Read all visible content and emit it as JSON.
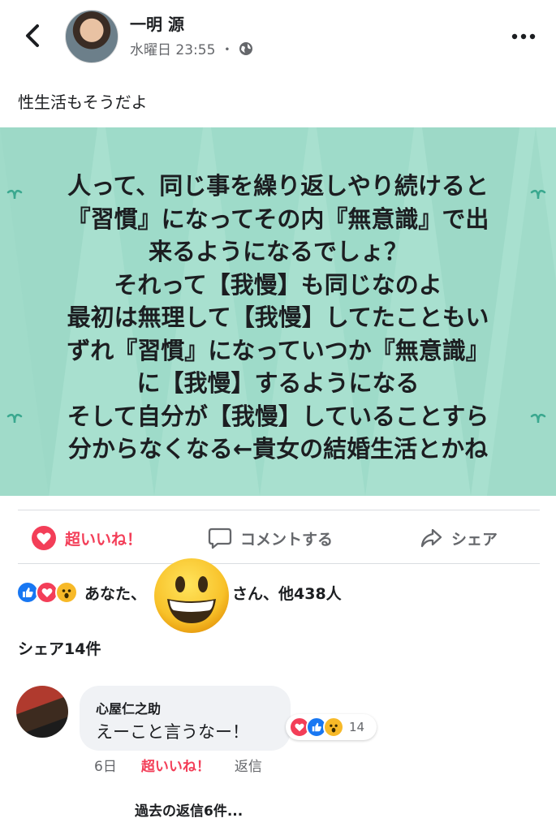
{
  "header": {
    "author_name": "一明 源",
    "timestamp": "水曜日 23:55",
    "separator": "・",
    "back_icon": "chevron-left-icon",
    "more_icon": "more-vertical-icon",
    "privacy_icon": "globe-icon"
  },
  "post": {
    "text": "性生活もそうだよ",
    "image_background": "#a8e0cf",
    "image_lines": [
      "人って、同じ事を繰り返しやり続けると",
      "『習慣』になってその内『無意識』で出",
      "来るようになるでしょ？",
      "それって【我慢】も同じなのよ",
      "最初は無理して【我慢】してたこともい",
      "ずれ『習慣』になっていつか『無意識』",
      "に【我慢】するようになる",
      "そして自分が【我慢】していることすら",
      "分からなくなる←貴女の結婚生活とかね"
    ]
  },
  "actions": {
    "like_label": "超いいね！",
    "comment_label": "コメントする",
    "share_label": "シェア",
    "like_color": "#f33e58"
  },
  "reactions": {
    "prefix": "あなた、",
    "suffix": "さん、他438人",
    "types": [
      "like",
      "love",
      "wow"
    ]
  },
  "shares": {
    "label": "シェア14件"
  },
  "comment": {
    "author": "心屋仁之助",
    "text": "えーこと言うなー！",
    "reaction_count": "14",
    "time": "6日",
    "liked_label": "超いいね！",
    "reply_label": "返信"
  },
  "previous_replies": "過去の返信6件..."
}
